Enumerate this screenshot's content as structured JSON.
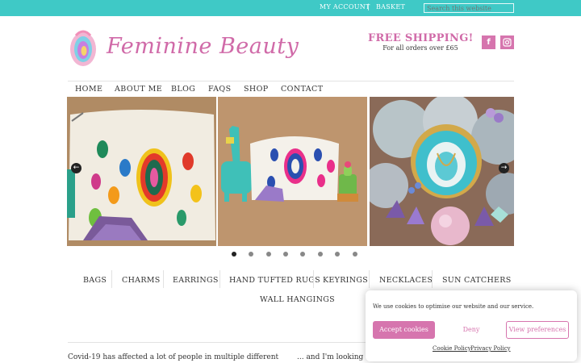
{
  "header": {
    "my_account": "MY ACCOUNT",
    "separator": "|",
    "basket": "BASKET",
    "search_placeholder": "Search this website",
    "bar_color": "#3fc9c6"
  },
  "brand": {
    "name": "Feminine Beauty",
    "accent_color": "#d06aa8"
  },
  "shipping": {
    "title": "FREE SHIPPING!",
    "subtitle": "For all orders over £65"
  },
  "social": [
    {
      "name": "facebook-icon",
      "glyph": "f"
    },
    {
      "name": "instagram-icon",
      "glyph": "◙"
    }
  ],
  "nav": [
    "HOME",
    "ABOUT ME",
    "BLOG",
    "FAQS",
    "SHOP",
    "CONTACT"
  ],
  "slider": {
    "prev_glyph": "←",
    "next_glyph": "→",
    "dot_count": 8,
    "active_dot": 1
  },
  "categories": [
    "BAGS",
    "CHARMS",
    "EARRINGS",
    "HAND TUFTED RUGS",
    "KEYRINGS",
    "NECKLACES",
    "SUN CATCHERS",
    "WALL HANGINGS"
  ],
  "content": {
    "para_left": "Covid-19 has affected a lot of people in multiple different",
    "para_right": "... and I'm looking to extend my range. You can find more about"
  },
  "cookie": {
    "message": "We use cookies to optimise our website and our service.",
    "accept": "Accept cookies",
    "deny": "Deny",
    "preferences": "View preferences",
    "cookie_policy": "Cookie Policy",
    "privacy_policy": "Privacy Policy"
  }
}
